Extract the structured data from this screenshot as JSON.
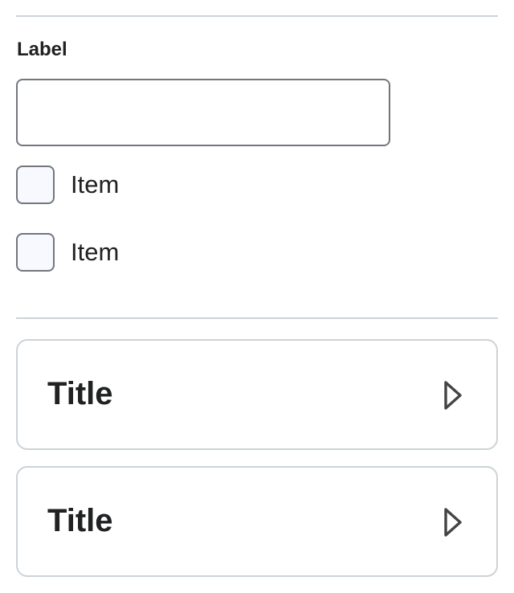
{
  "form": {
    "label": "Label",
    "input_value": "",
    "input_placeholder": "",
    "checkboxes": [
      {
        "label": "Item",
        "checked": false
      },
      {
        "label": "Item",
        "checked": false
      }
    ]
  },
  "cards": [
    {
      "title": "Title",
      "icon": "chevron-right-icon"
    },
    {
      "title": "Title",
      "icon": "chevron-right-icon"
    }
  ],
  "colors": {
    "text": "#202122",
    "border": "#72777d",
    "divider": "#cdd3d7",
    "checkbox_fill": "#f8f9ff"
  }
}
